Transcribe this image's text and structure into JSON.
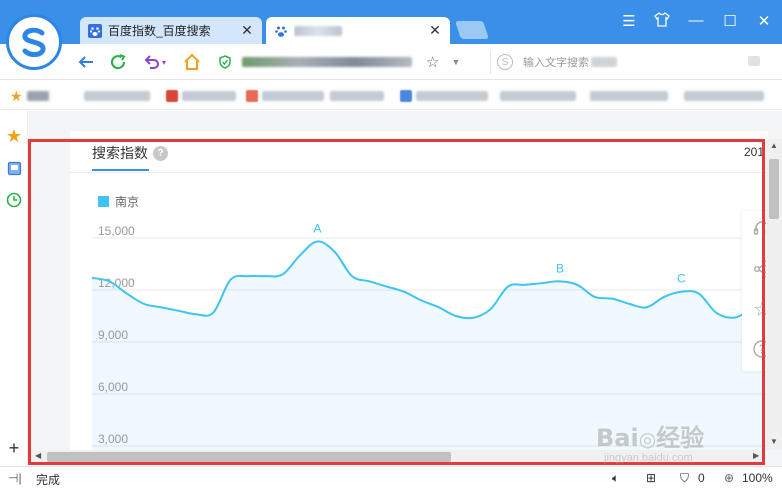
{
  "browser": {
    "tabs": [
      {
        "title": "百度指数_百度搜索",
        "active": false
      },
      {
        "title": "",
        "active": true
      }
    ],
    "address": {
      "url": "https://index.baidu.com",
      "search_placeholder": "输入文字搜索"
    },
    "status": {
      "text": "完成",
      "badge": "0",
      "zoom": "100%"
    }
  },
  "page": {
    "tab_label": "搜索指数",
    "year_label": "201",
    "legend": "南京",
    "accent_color": "#3a8fe8",
    "series_color": "#3ec3f2",
    "frame_color": "#e33b3b"
  },
  "chart_data": {
    "type": "area",
    "title": "",
    "xlabel": "",
    "ylabel": "",
    "series": [
      {
        "name": "南京",
        "values": [
          12700,
          12500,
          11800,
          11200,
          11000,
          10800,
          10600,
          10700,
          12600,
          12800,
          12800,
          12900,
          14000,
          14800,
          14200,
          12800,
          12500,
          12200,
          11900,
          11400,
          11000,
          10500,
          10400,
          10900,
          12200,
          12300,
          12400,
          12500,
          12300,
          11600,
          11500,
          11200,
          11000,
          11600,
          11900,
          11800,
          10700,
          10400,
          10800,
          11000
        ]
      }
    ],
    "yticks": [
      15000,
      12000,
      9000,
      6000,
      3000
    ],
    "ytick_labels": [
      "15,000",
      "12,000",
      "9,000",
      "6,000",
      "3,000"
    ],
    "ylim": [
      3000,
      15000
    ],
    "annotations": [
      {
        "label": "A",
        "index": 13
      },
      {
        "label": "B",
        "index": 27
      },
      {
        "label": "C",
        "index": 34
      }
    ],
    "grid": true
  }
}
